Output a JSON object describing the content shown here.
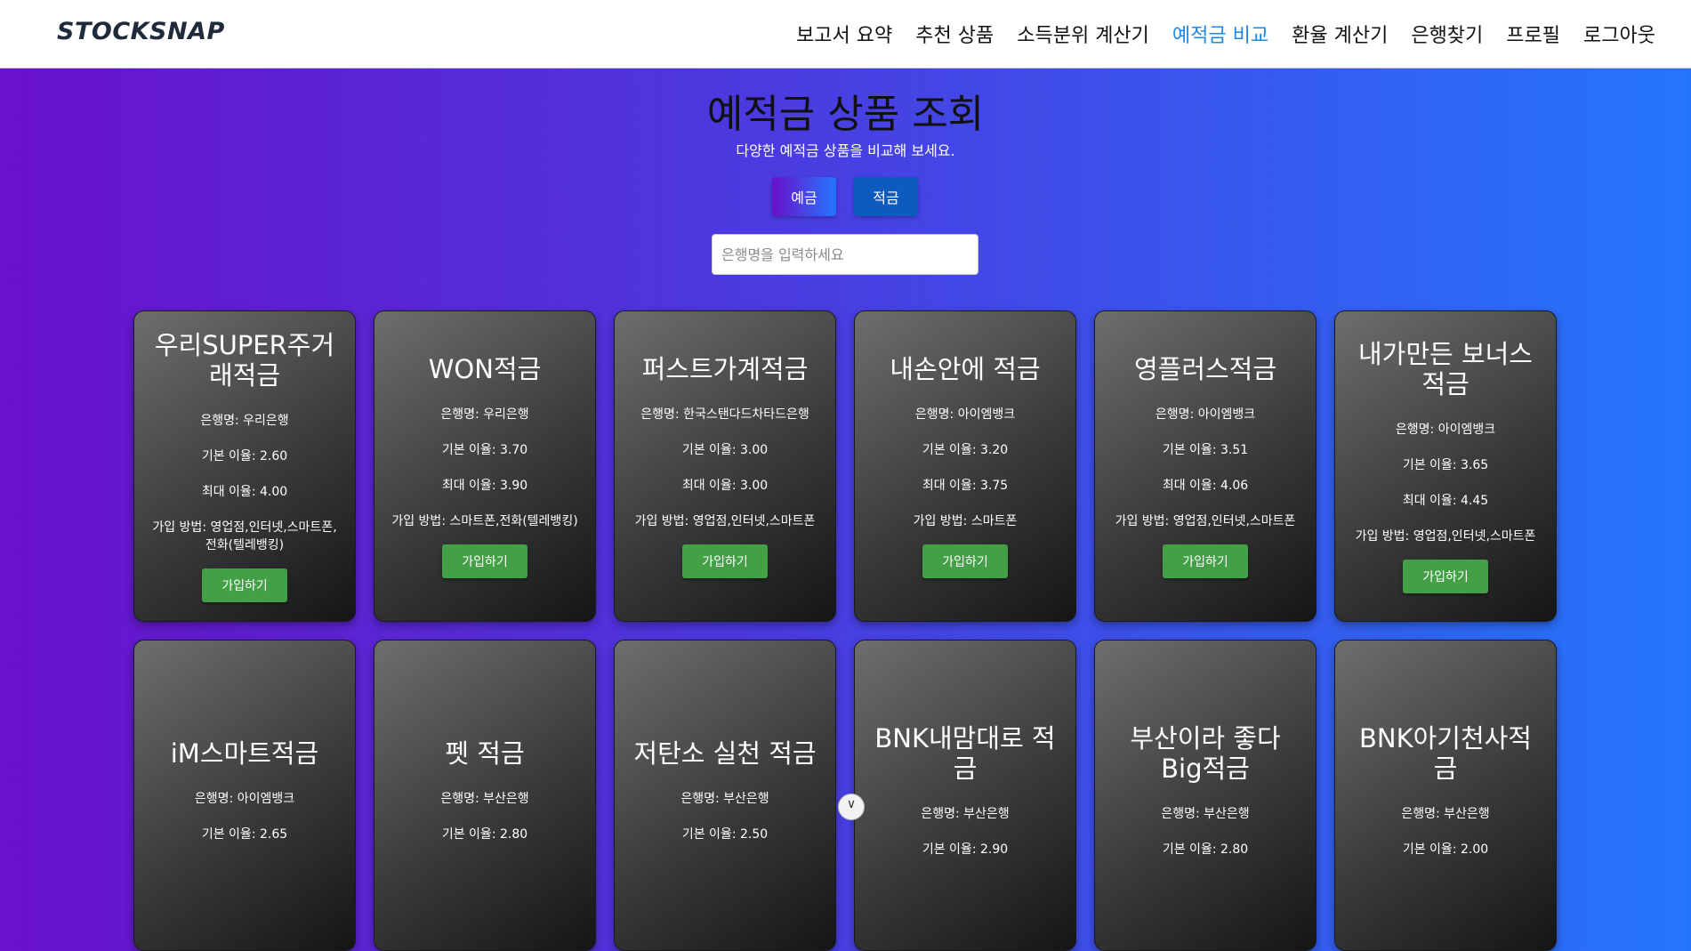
{
  "brand": "STOCKSNAP",
  "nav": {
    "items": [
      "보고서 요약",
      "추천 상품",
      "소득분위 계산기",
      "예적금 비교",
      "환율 계산기",
      "은행찾기",
      "프로필",
      "로그아웃"
    ],
    "active": "예적금 비교"
  },
  "page": {
    "title": "예적금 상품 조회",
    "subtitle": "다양한 예적금 상품을 비교해 보세요."
  },
  "toggle": {
    "deposit": "예금",
    "savings": "적금"
  },
  "search": {
    "placeholder": "은행명을 입력하세요",
    "value": ""
  },
  "labels": {
    "bank": "은행명",
    "base_rate": "기본 이율",
    "max_rate": "최대 이율",
    "join_method": "가입 방법",
    "join_button": "가입하기"
  },
  "colors": {
    "accent_nav": "#1e88e5",
    "join_button": "#43a047",
    "gradient_start": "#6a11cb",
    "gradient_end": "#2575fc"
  },
  "products": [
    {
      "name": "우리SUPER주거래적금",
      "bank": "우리은행",
      "base_rate": "2.60",
      "max_rate": "4.00",
      "join_method": "영업점,인터넷,스마트폰,전화(텔레뱅킹)"
    },
    {
      "name": "WON적금",
      "bank": "우리은행",
      "base_rate": "3.70",
      "max_rate": "3.90",
      "join_method": "스마트폰,전화(텔레뱅킹)"
    },
    {
      "name": "퍼스트가계적금",
      "bank": "한국스탠다드차타드은행",
      "base_rate": "3.00",
      "max_rate": "3.00",
      "join_method": "영업점,인터넷,스마트폰"
    },
    {
      "name": "내손안에 적금",
      "bank": "아이엠뱅크",
      "base_rate": "3.20",
      "max_rate": "3.75",
      "join_method": "스마트폰"
    },
    {
      "name": "영플러스적금",
      "bank": "아이엠뱅크",
      "base_rate": "3.51",
      "max_rate": "4.06",
      "join_method": "영업점,인터넷,스마트폰"
    },
    {
      "name": "내가만든 보너스적금",
      "bank": "아이엠뱅크",
      "base_rate": "3.65",
      "max_rate": "4.45",
      "join_method": "영업점,인터넷,스마트폰"
    },
    {
      "name": "iM스마트적금",
      "bank": "아이엠뱅크",
      "base_rate": "2.65",
      "max_rate": "",
      "join_method": ""
    },
    {
      "name": "펫 적금",
      "bank": "부산은행",
      "base_rate": "2.80",
      "max_rate": "",
      "join_method": ""
    },
    {
      "name": "저탄소 실천 적금",
      "bank": "부산은행",
      "base_rate": "2.50",
      "max_rate": "",
      "join_method": ""
    },
    {
      "name": "BNK내맘대로 적금",
      "bank": "부산은행",
      "base_rate": "2.90",
      "max_rate": "",
      "join_method": ""
    },
    {
      "name": "부산이라 좋다 Big적금",
      "bank": "부산은행",
      "base_rate": "2.80",
      "max_rate": "",
      "join_method": ""
    },
    {
      "name": "BNK아기천사적금",
      "bank": "부산은행",
      "base_rate": "2.00",
      "max_rate": "",
      "join_method": ""
    }
  ]
}
